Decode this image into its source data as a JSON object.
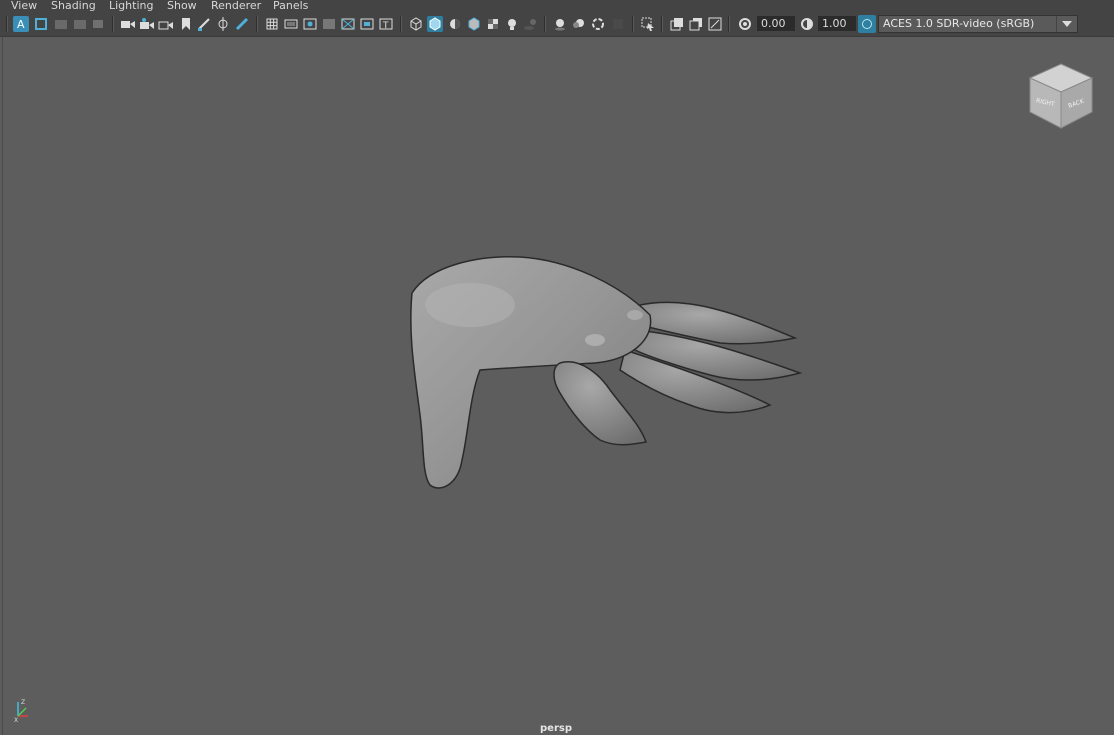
{
  "menus": [
    "View",
    "Shading",
    "Lighting",
    "Show",
    "Renderer",
    "Panels"
  ],
  "toolbar": {
    "exposure_value": "0.00",
    "gamma_value": "1.00",
    "colorspace": "ACES 1.0 SDR-video (sRGB)"
  },
  "viewport": {
    "camera_label": "persp",
    "viewcube_faces": [
      "RIGHT",
      "BACK"
    ]
  },
  "colors": {
    "background": "#5d5d5d",
    "toolbar": "#444444",
    "accent": "#2f7fa1"
  }
}
